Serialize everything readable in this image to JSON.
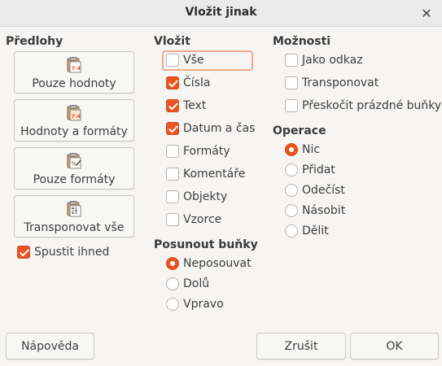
{
  "window": {
    "title": "Vložit jinak"
  },
  "presets": {
    "heading": "Předlohy",
    "items": [
      {
        "label": "Pouze hodnoty",
        "icon": "paste-values-icon"
      },
      {
        "label": "Hodnoty a formáty",
        "icon": "paste-values-formats-icon"
      },
      {
        "label": "Pouze formáty",
        "icon": "paste-formats-icon"
      },
      {
        "label": "Transponovat vše",
        "icon": "paste-transpose-icon"
      }
    ],
    "run_immediately": {
      "label": "Spustit ihned",
      "checked": true
    }
  },
  "paste": {
    "heading": "Vložit",
    "items": [
      {
        "label": "Vše",
        "checked": false
      },
      {
        "label": "Čísla",
        "checked": true
      },
      {
        "label": "Text",
        "checked": true
      },
      {
        "label": "Datum a čas",
        "checked": true
      },
      {
        "label": "Formáty",
        "checked": false
      },
      {
        "label": "Komentáře",
        "checked": false
      },
      {
        "label": "Objekty",
        "checked": false
      },
      {
        "label": "Vzorce",
        "checked": false
      }
    ]
  },
  "shift": {
    "heading": "Posunout buňky",
    "items": [
      {
        "label": "Neposouvat",
        "selected": true
      },
      {
        "label": "Dolů",
        "selected": false
      },
      {
        "label": "Vpravo",
        "selected": false
      }
    ]
  },
  "options": {
    "heading": "Možnosti",
    "items": [
      {
        "label": "Jako odkaz",
        "checked": false
      },
      {
        "label": "Transponovat",
        "checked": false
      },
      {
        "label": "Přeskočit prázdné buňky",
        "checked": false
      }
    ]
  },
  "operation": {
    "heading": "Operace",
    "items": [
      {
        "label": "Nic",
        "selected": true
      },
      {
        "label": "Přidat",
        "selected": false
      },
      {
        "label": "Odečíst",
        "selected": false
      },
      {
        "label": "Násobit",
        "selected": false
      },
      {
        "label": "Dělit",
        "selected": false
      }
    ]
  },
  "buttons": {
    "help": "Nápověda",
    "cancel": "Zrušit",
    "ok": "OK"
  },
  "colors": {
    "accent": "#e95420",
    "focus_ring": "#f2a98c",
    "background": "#f6f5f4"
  }
}
